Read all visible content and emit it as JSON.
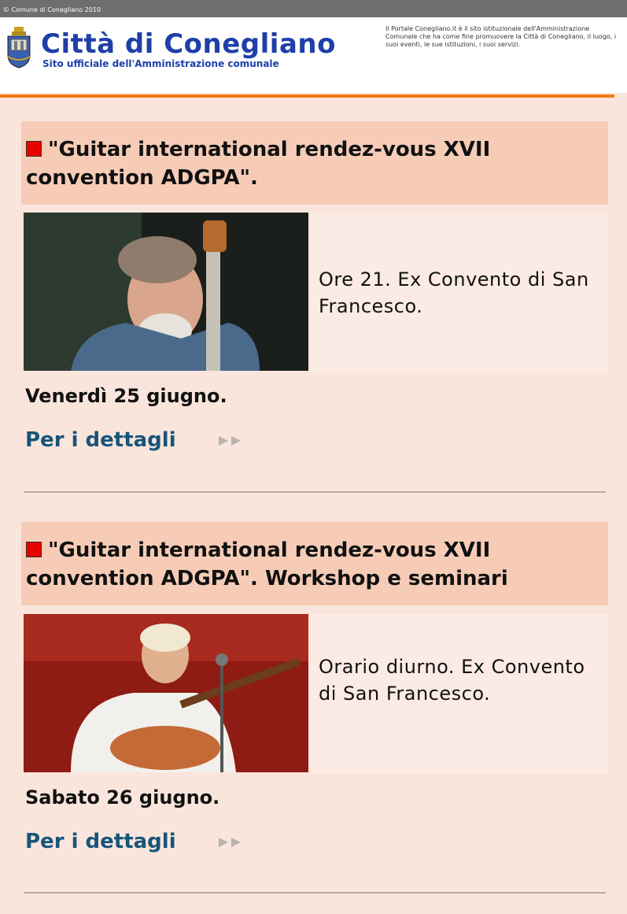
{
  "header": {
    "topbar_text": "© Comune di Conegliano 2010",
    "title": "Città di Conegliano",
    "subtitle": "Sito ufficiale dell'Amministrazione comunale",
    "blurb": "Il Portale Conegliano.it è il sito istituzionale dell'Amministrazione Comunale che ha come fine promuovere la Città di Conegliano, il luogo, i suoi eventi, le sue istituzioni, i suoi servizi."
  },
  "colors": {
    "accent_orange": "#f07a10",
    "title_blue": "#1f3fa8",
    "link_blue": "#17557a",
    "bullet_red": "#e80000",
    "page_bg": "#f9e5dc",
    "title_bg": "#f6ccb7"
  },
  "events": [
    {
      "title": "\"Guitar international rendez-vous XVII convention ADGPA\".",
      "description": "Ore 21. Ex Convento di San Francesco.",
      "date": "Venerdì 25 giugno.",
      "link_label": "Per i dettagli",
      "icon": "double-arrow-right-icon"
    },
    {
      "title": "\"Guitar international rendez-vous XVII convention ADGPA\". Workshop e seminari",
      "description": "Orario diurno. Ex Convento di San Francesco.",
      "date": "Sabato 26 giugno.",
      "link_label": "Per i dettagli",
      "icon": "double-arrow-right-icon"
    }
  ]
}
